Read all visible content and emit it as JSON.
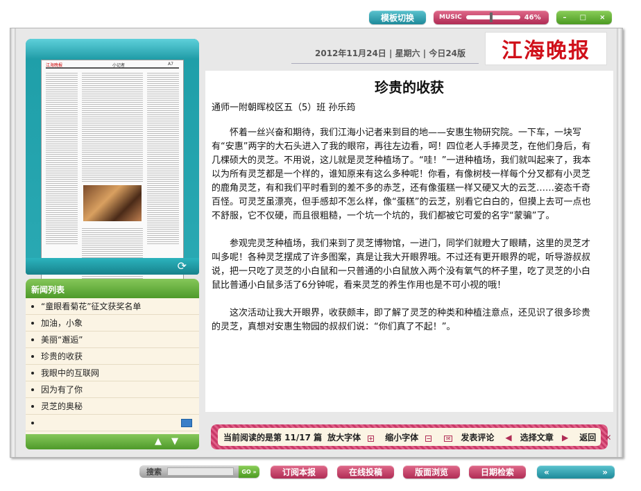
{
  "top": {
    "template_switch": "模板切换",
    "music_label": "MUSIC",
    "music_volume": "46%",
    "music_level": 0.46,
    "window_min": "–",
    "window_max": "□",
    "window_close": "×"
  },
  "masthead": {
    "name": "江海晚报",
    "date": "2012年11月24日",
    "weekday": "星期六",
    "pages": "今日24版"
  },
  "thumbnail": {
    "paper_mast": "江海晚报",
    "section": "小记者",
    "page_no": "A7"
  },
  "news": {
    "heading": "新闻列表",
    "items": [
      "“童眼看菊花”征文获奖名单",
      "加油，小象",
      "美丽“邂逅”",
      "珍贵的收获",
      "我眼中的互联网",
      "因为有了你",
      "灵芝的奥秘",
      ""
    ]
  },
  "article": {
    "title": "珍贵的收获",
    "author": "通师一附朝晖校区五（5）班  孙乐筠",
    "paragraphs": [
      "怀着一丝兴奋和期待，我们江海小记者来到目的地——安惠生物研究院。一下车，一块写有“安惠”两字的大石头进入了我的眼帘，再往左边看，呵！四位老人手捧灵芝，在他们身后，有几棵硕大的灵芝。不用说，这儿就是灵芝种植场了。“哇！”一进种植场，我们就叫起来了，我本以为所有灵芝都是一个样的，谁知原来有这么多种呢！你看，有像树枝一样每个分叉都有小灵芝的鹿角灵芝，有和我们平时看到的差不多的赤芝，还有像蛋糕一样又硬又大的云芝……姿态千奇百怪。可灵芝虽漂亮，但手感却不怎么样，像“蛋糕”的云芝，别看它白白的，但摸上去可一点也不舒服，它不仅硬，而且很粗糙，一个坑一个坑的，我们都被它可爱的名字“蒙骗”了。",
      "参观完灵芝种植场，我们来到了灵芝博物馆，一进门，同学们就瞪大了眼睛，这里的灵芝才叫多呢！各种灵芝摆成了许多图案，真是让我大开眼界哦。不过还有更开眼界的呢，听导游叔叔说，把一只吃了灵芝的小白鼠和一只普通的小白鼠放入两个没有氧气的杯子里，吃了灵芝的小白鼠比普通小白鼠多活了6分钟呢，看来灵芝的养生作用也是不可小视的哦！",
      "这次活动让我大开眼界，收获颇丰，即了解了灵芝的种类和种植注意点，还见识了很多珍贵的灵芝，真想对安惠生物园的叔叔们说：“你们真了不起！”。"
    ]
  },
  "readbar": {
    "current": "当前阅读的是第  11/17  篇",
    "zoom_in": "放大字体",
    "zoom_out": "缩小字体",
    "comment": "发表评论",
    "select": "选择文章",
    "back": "返回"
  },
  "bottom": {
    "search_label": "搜索",
    "search_go": "GO »",
    "subscribe": "订阅本报",
    "submit": "在线投稿",
    "browse": "版面浏览",
    "date_search": "日期检索",
    "prev": "«",
    "next": "»"
  }
}
